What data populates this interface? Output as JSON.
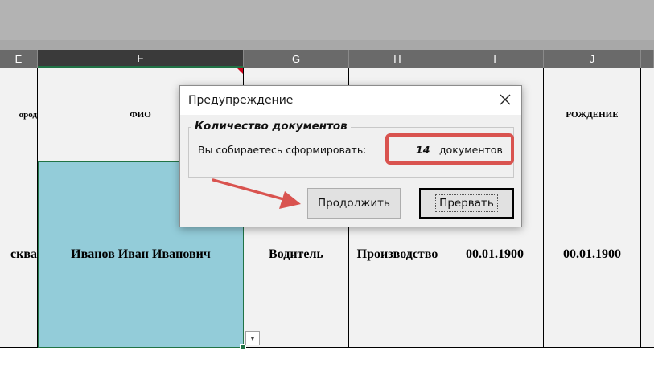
{
  "sheet": {
    "columns": [
      "E",
      "F",
      "G",
      "H",
      "I",
      "J"
    ],
    "selected_column": "F",
    "header_row": {
      "e": "ород",
      "f": "ФИО",
      "j": "РОЖДЕНИЕ"
    },
    "data_row": {
      "e": "сква",
      "f": "Иванов Иван Иванович",
      "g": "Водитель",
      "h": "Производство",
      "i": "00.01.1900",
      "j": "00.01.1900"
    }
  },
  "dialog": {
    "title": "Предупреждение",
    "group_title": "Количество документов",
    "message": "Вы собираетесь сформировать:",
    "count": "14",
    "count_unit": "документов",
    "continue_label": "Продолжить",
    "abort_label": "Прервать"
  },
  "icons": {
    "close": "close-icon",
    "dropdown": "chevron-down-icon"
  },
  "colors": {
    "highlight": "#d9534f",
    "selected_cell": "#93ccd9",
    "excel_green": "#217346"
  }
}
